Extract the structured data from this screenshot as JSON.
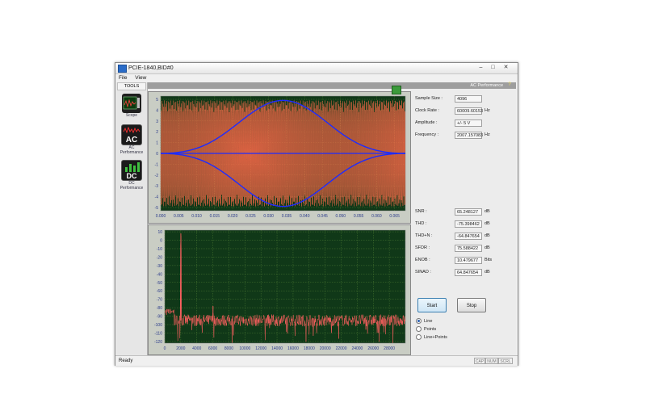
{
  "window": {
    "title": "PCIE-1840,BID#0",
    "controls": [
      "–",
      "□",
      "✕"
    ]
  },
  "menu": [
    "File",
    "View"
  ],
  "tools": {
    "header": "TOOLS",
    "items": [
      {
        "label": "Scope",
        "icon": "scope-icon"
      },
      {
        "label": "AC\nPerformance",
        "icon": "ac-performance-icon",
        "icon_text": "AC"
      },
      {
        "label": "DC\nPerformance",
        "icon": "dc-performance-icon",
        "icon_text": "DC"
      }
    ]
  },
  "panel": {
    "title": "AC Performance"
  },
  "signal_info": [
    {
      "label": "Sample Size :",
      "value": "4096",
      "unit": ""
    },
    {
      "label": "Clock Rate :",
      "value": "60009.60153",
      "unit": "Hz"
    },
    {
      "label": "Amplitude :",
      "value": "+/- 5 V",
      "unit": ""
    },
    {
      "label": "Frequency :",
      "value": "2007.157083",
      "unit": "Hz"
    }
  ],
  "metrics": [
    {
      "label": "SNR :",
      "value": "65.248127",
      "unit": "dB"
    },
    {
      "label": "THD :",
      "value": "-75.398462",
      "unit": "dB"
    },
    {
      "label": "THD+N :",
      "value": "-64.847654",
      "unit": "dB"
    },
    {
      "label": "SFDR :",
      "value": "75.588422",
      "unit": "dB"
    },
    {
      "label": "ENOB :",
      "value": "10.479677",
      "unit": "Bits"
    },
    {
      "label": "SINAD :",
      "value": "64.847654",
      "unit": "dB"
    }
  ],
  "buttons": {
    "start": "Start",
    "stop": "Stop"
  },
  "display_modes": [
    {
      "label": "Line",
      "selected": true
    },
    {
      "label": "Points",
      "selected": false
    },
    {
      "label": "Line+Points",
      "selected": false
    }
  ],
  "status": {
    "text": "Ready",
    "indicators": [
      "CAP",
      "NUM",
      "SCRL"
    ]
  },
  "chart_data": [
    {
      "type": "line",
      "name": "time-domain",
      "x_ticks": [
        "0.000",
        "0.005",
        "0.010",
        "0.015",
        "0.020",
        "0.025",
        "0.030",
        "0.035",
        "0.040",
        "0.045",
        "0.050",
        "0.055",
        "0.060",
        "0.065"
      ],
      "y_ticks": [
        "5",
        "4",
        "3",
        "2",
        "1",
        "0",
        "-1",
        "-2",
        "-3",
        "-4",
        "-5"
      ],
      "xlim": [
        0,
        0.068
      ],
      "ylim": [
        -5.3,
        5.3
      ],
      "signal_frequency_hz": 2007.157083,
      "signal_amplitude": 4.9,
      "window_envelope": "blackman",
      "signal_color": "#ff6a4a",
      "envelope_color": "#1e2cff",
      "grid": true
    },
    {
      "type": "line",
      "name": "spectrum",
      "x_ticks": [
        "0",
        "2000",
        "4000",
        "6000",
        "8000",
        "10000",
        "12000",
        "14000",
        "16000",
        "18000",
        "20000",
        "22000",
        "24000",
        "26000",
        "28000"
      ],
      "y_ticks": [
        "10",
        "0",
        "-10",
        "-20",
        "-30",
        "-40",
        "-50",
        "-60",
        "-70",
        "-80",
        "-90",
        "-100",
        "-110",
        "-120"
      ],
      "xlim": [
        0,
        30000
      ],
      "ylim": [
        -122,
        12
      ],
      "peaks": [
        {
          "x": 2007,
          "y": 8
        },
        {
          "x": 6020,
          "y": -78
        }
      ],
      "noise_floor": -95,
      "line_color": "#ff6060",
      "grid": true
    }
  ],
  "colors": {
    "graph_bg": "#103818",
    "grid": "#5a8a3a",
    "panel_header": "#9e9e9e"
  }
}
